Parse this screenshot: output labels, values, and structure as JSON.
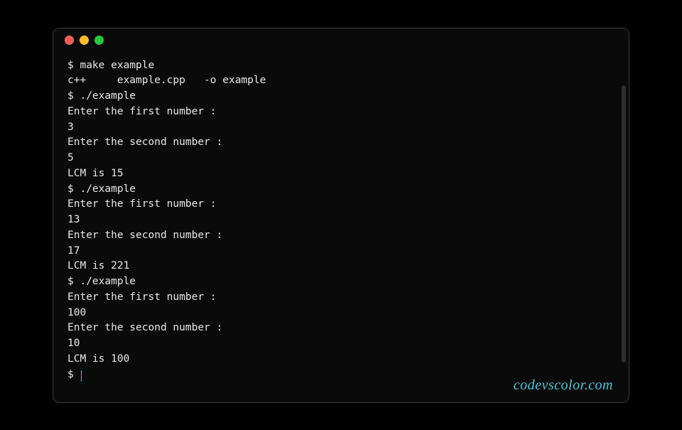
{
  "window": {
    "controls": {
      "close": "close",
      "minimize": "minimize",
      "zoom": "zoom"
    }
  },
  "terminal": {
    "lines": [
      "$ make example",
      "c++     example.cpp   -o example",
      "$ ./example",
      "Enter the first number :",
      "3",
      "Enter the second number :",
      "5",
      "LCM is 15",
      "$ ./example",
      "Enter the first number :",
      "13",
      "Enter the second number :",
      "17",
      "LCM is 221",
      "$ ./example",
      "Enter the first number :",
      "100",
      "Enter the second number :",
      "10",
      "LCM is 100"
    ],
    "prompt": "$ "
  },
  "watermark": "codevscolor.com"
}
